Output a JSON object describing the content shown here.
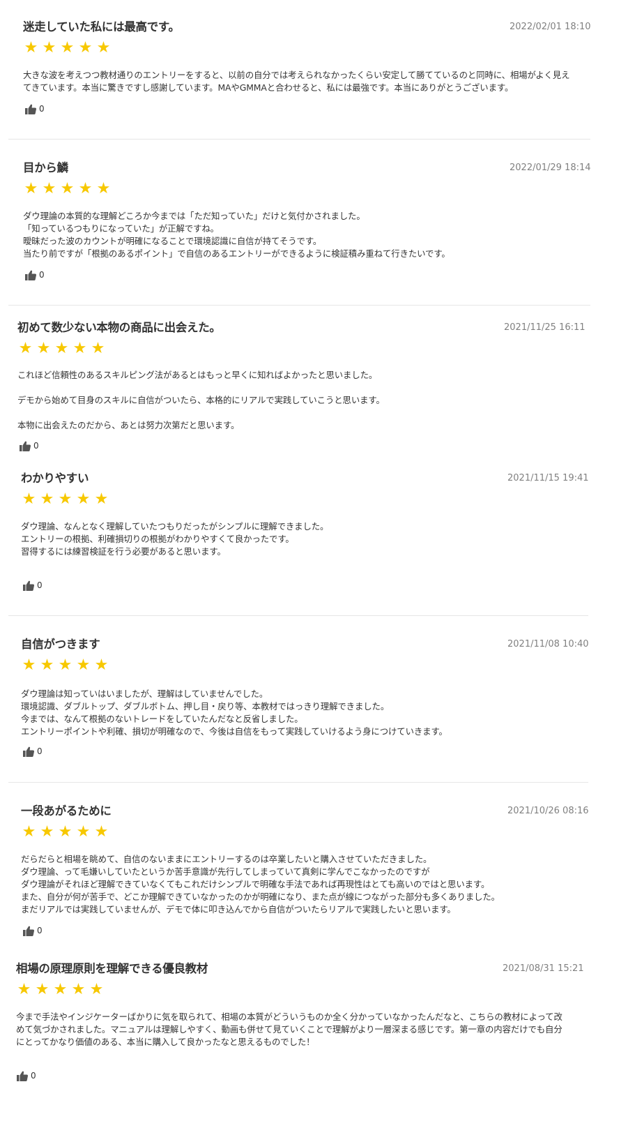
{
  "rating_color": "#f7c800",
  "star_glyph": "★",
  "reviews": [
    {
      "title": "迷走していた私には最高です。",
      "date": "2022/02/01 18:10",
      "stars": 5,
      "body": [
        "大きな波を考えつつ教材通りのエントリーをすると、以前の自分では考えられなかったくらい安定して勝てているのと同時に、相場がよく見え",
        "てきています。本当に驚きですし感謝しています。MAやGMMAと合わせると、私には最強です。本当にありがとうございます。"
      ],
      "likes": "0"
    },
    {
      "title": "目から鱗",
      "date": "2022/01/29 18:14",
      "stars": 5,
      "body": [
        "ダウ理論の本質的な理解どころか今までは「ただ知っていた」だけと気付かされました。",
        "「知っているつもりになっていた」が正解ですね。",
        "曖昧だった波のカウントが明確になることで環境認識に自信が持てそうです。",
        "当たり前ですが「根拠のあるポイント」で自信のあるエントリーができるように検証積み重ねて行きたいです。"
      ],
      "likes": "0"
    },
    {
      "title": "初めて数少ない本物の商品に出会えた。",
      "date": "2021/11/25 16:11",
      "stars": 5,
      "body": [
        "これほど信頼性のあるスキルピング法があるとはもっと早くに知ればよかったと思いました。",
        "",
        "デモから始めて目身のスキルに自信がついたら、本格的にリアルで実践していこうと思います。",
        "",
        "本物に出会えたのだから、あとは努力次第だと思います。"
      ],
      "likes": "0"
    },
    {
      "title": "わかりやすい",
      "date": "2021/11/15 19:41",
      "stars": 5,
      "body": [
        "ダウ理論、なんとなく理解していたつもりだったがシンプルに理解できました。",
        "エントリーの根拠、利確損切りの根拠がわかりやすくて良かったです。",
        "習得するには練習検証を行う必要があると思います。"
      ],
      "likes": "0"
    },
    {
      "title": "自信がつきます",
      "date": "2021/11/08 10:40",
      "stars": 5,
      "body": [
        "ダウ理論は知っていはいましたが、理解はしていませんでした。",
        "環境認識、ダブルトップ、ダブルボトム、押し目・戻り等、本教材ではっきり理解できました。",
        "今までは、なんて根拠のないトレードをしていたんだなと反省しました。",
        "エントリーポイントや利確、損切が明確なので、今後は自信をもって実践していけるよう身につけていきます。"
      ],
      "likes": "0"
    },
    {
      "title": "一段あがるために",
      "date": "2021/10/26 08:16",
      "stars": 5,
      "body": [
        "だらだらと相場を眺めて、自信のないままにエントリーするのは卒業したいと購入させていただきました。",
        "ダウ理論、って毛嫌いしていたというか苦手意識が先行してしまっていて真剣に学んでこなかったのですが",
        "ダウ理論がそれほど理解できていなくてもこれだけシンプルで明確な手法であれば再現性はとても高いのではと思います。",
        "また、自分が何が苦手で、どこか理解できていなかったのかが明確になり、また点が線につながった部分も多くありました。",
        "まだリアルでは実践していませんが、デモで体に叩き込んでから自信がついたらリアルで実践したいと思います。"
      ],
      "likes": "0"
    },
    {
      "title": "相場の原理原則を理解できる優良教材",
      "date": "2021/08/31 15:21",
      "stars": 5,
      "body": [
        "今まで手法やインジケーターばかりに気を取られて、相場の本質がどういうものか全く分かっていなかったんだなと、こちらの教材によって改",
        "めて気づかされました。マニュアルは理解しやすく、動画も併せて見ていくことで理解がより一層深まる感じです。第一章の内容だけでも自分",
        "にとってかなり価値のある、本当に購入して良かったなと思えるものでした！"
      ],
      "likes": "0"
    }
  ]
}
